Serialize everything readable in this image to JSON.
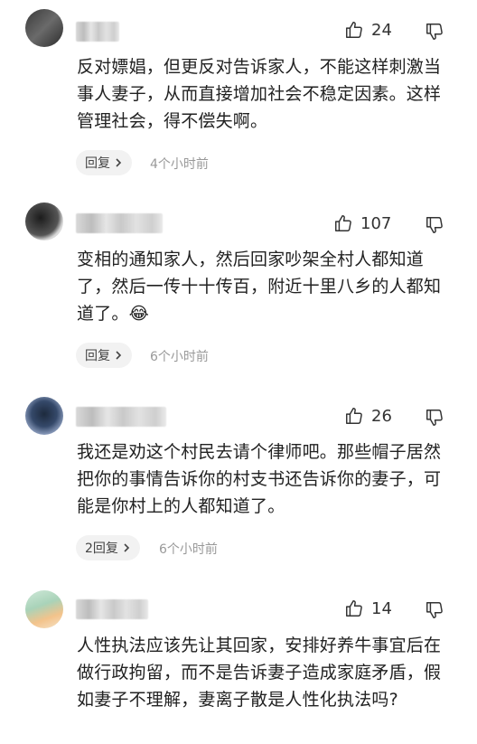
{
  "comments": [
    {
      "likes": "24",
      "text": "反对嫖娼，但更反对告诉家人，不能这样刺激当事人妻子，从而直接增加社会不稳定因素。这样管理社会，得不偿失啊。",
      "reply_label": "回复",
      "time": "4个小时前"
    },
    {
      "likes": "107",
      "text": "变相的通知家人，然后回家吵架全村人都知道了，然后一传十十传百，附近十里八乡的人都知道了。",
      "emoji": "😂",
      "reply_label": "回复",
      "time": "6个小时前"
    },
    {
      "likes": "26",
      "text": "我还是劝这个村民去请个律师吧。那些帽子居然把你的事情告诉你的村支书还告诉你的妻子，可能是你村上的人都知道了。",
      "reply_label": "2回复",
      "time": "6个小时前"
    },
    {
      "likes": "14",
      "text": "人性执法应该先让其回家，安排好养牛事宜后在做行政拘留，而不是告诉妻子造成家庭矛盾，假如妻子不理解，妻离子散是人性化执法吗?"
    }
  ],
  "icons": {
    "like": "thumbs-up-icon",
    "dislike": "thumbs-down-icon",
    "chevron": "chevron-right-icon"
  }
}
